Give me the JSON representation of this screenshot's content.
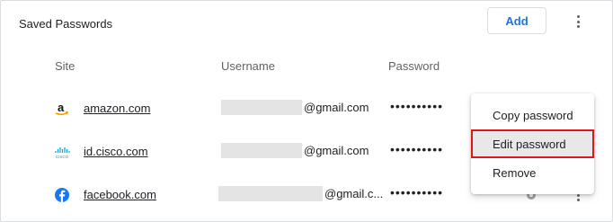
{
  "section": {
    "title": "Saved Passwords",
    "add_label": "Add"
  },
  "columns": {
    "site": "Site",
    "username": "Username",
    "password": "Password"
  },
  "rows": [
    {
      "site": "amazon.com",
      "icon": "amazon-icon",
      "username_suffix": "@gmail.com",
      "password_mask": "••••••••••"
    },
    {
      "site": "id.cisco.com",
      "icon": "cisco-icon",
      "username_suffix": "@gmail.com",
      "password_mask": "••••••••••"
    },
    {
      "site": "facebook.com",
      "icon": "facebook-icon",
      "username_suffix": "@gmail.c...",
      "password_mask": "••••••••••"
    }
  ],
  "context_menu": {
    "items": [
      "Copy password",
      "Edit password",
      "Remove"
    ],
    "highlighted": "Edit password"
  },
  "colors": {
    "accent": "#1a73e8",
    "highlight_border": "#e0161d",
    "facebook": "#1877f2",
    "cisco": "#049fd9",
    "amazon_arrow": "#ff9900"
  }
}
